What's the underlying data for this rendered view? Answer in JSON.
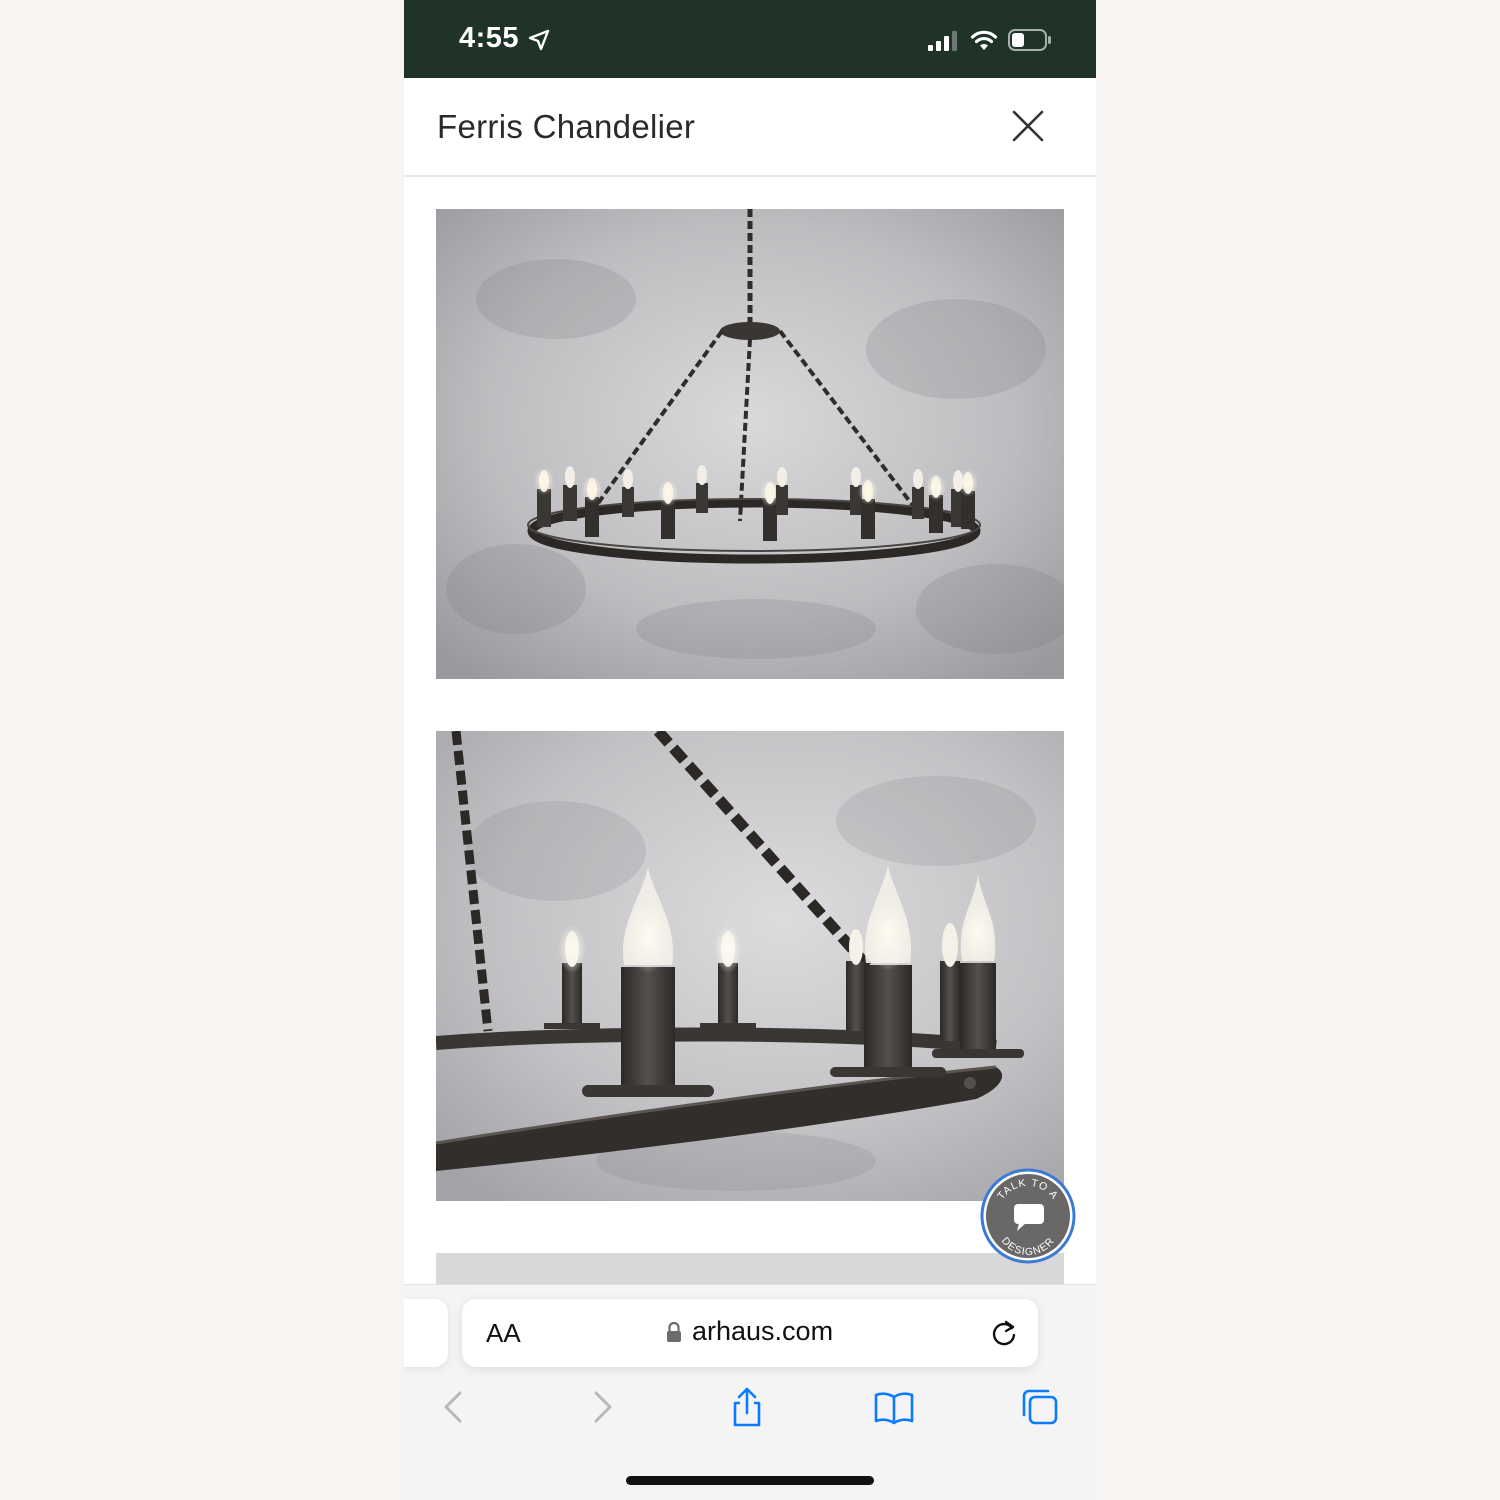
{
  "status_bar": {
    "time": "4:55",
    "icons": [
      "location-arrow-icon",
      "cellular-signal-icon",
      "wifi-icon",
      "battery-icon"
    ]
  },
  "header": {
    "title": "Ferris Chandelier",
    "close_icon": "close-icon"
  },
  "gallery": {
    "images": [
      "chandelier-full-view",
      "chandelier-close-up",
      "chandelier-third-image"
    ]
  },
  "chat_badge": {
    "text_top": "TALK TO A",
    "text_bottom": "DESIGNER",
    "icon": "chat-bubble-icon",
    "ring_color": "#3a7bd5"
  },
  "browser": {
    "text_size_button": "AA",
    "url": "arhaus.com",
    "icons": [
      "lock-icon",
      "reload-icon",
      "back-icon",
      "forward-icon",
      "share-icon",
      "bookmarks-icon",
      "tabs-icon"
    ],
    "accent_color": "#0a7aff"
  },
  "colors": {
    "status_bar": "#1f3329",
    "background": "#f7f4f1"
  }
}
